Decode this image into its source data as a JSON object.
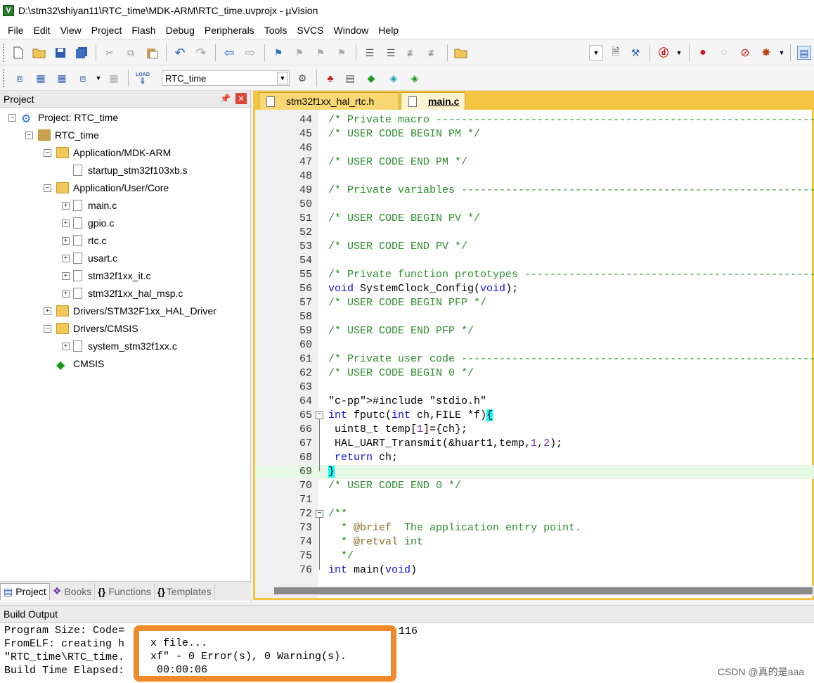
{
  "window": {
    "title": "D:\\stm32\\shiyan11\\RTC_time\\MDK-ARM\\RTC_time.uvprojx - µVision",
    "icon_letter": "V"
  },
  "menu": [
    "File",
    "Edit",
    "View",
    "Project",
    "Flash",
    "Debug",
    "Peripherals",
    "Tools",
    "SVCS",
    "Window",
    "Help"
  ],
  "toolbar2": {
    "target": "RTC_time",
    "load_label": "LOAD"
  },
  "project_panel": {
    "title": "Project",
    "pin": "❓",
    "tree": [
      {
        "label": "Project: RTC_time"
      },
      {
        "label": "RTC_time"
      },
      {
        "label": "Application/MDK-ARM"
      },
      {
        "label": "startup_stm32f103xb.s"
      },
      {
        "label": "Application/User/Core"
      },
      {
        "label": "main.c"
      },
      {
        "label": "gpio.c"
      },
      {
        "label": "rtc.c"
      },
      {
        "label": "usart.c"
      },
      {
        "label": "stm32f1xx_it.c"
      },
      {
        "label": "stm32f1xx_hal_msp.c"
      },
      {
        "label": "Drivers/STM32F1xx_HAL_Driver"
      },
      {
        "label": "Drivers/CMSIS"
      },
      {
        "label": "system_stm32f1xx.c"
      },
      {
        "label": "CMSIS"
      }
    ],
    "tabs": [
      "Project",
      "Books",
      "Functions",
      "Templates"
    ]
  },
  "editor": {
    "tabs": [
      "stm32f1xx_hal_rtc.h",
      "main.c"
    ],
    "lines": [
      {
        "n": "44",
        "t": "/* Private macro -------------------------------------------------------------"
      },
      {
        "n": "45",
        "t": "/* USER CODE BEGIN PM */"
      },
      {
        "n": "46",
        "t": ""
      },
      {
        "n": "47",
        "t": "/* USER CODE END PM */"
      },
      {
        "n": "48",
        "t": ""
      },
      {
        "n": "49",
        "t": "/* Private variables ---------------------------------------------------------"
      },
      {
        "n": "50",
        "t": ""
      },
      {
        "n": "51",
        "t": "/* USER CODE BEGIN PV */"
      },
      {
        "n": "52",
        "t": ""
      },
      {
        "n": "53",
        "t": "/* USER CODE END PV */"
      },
      {
        "n": "54",
        "t": ""
      },
      {
        "n": "55",
        "t": "/* Private function prototypes -----------------------------------------------"
      },
      {
        "n": "56",
        "t": "void SystemClock_Config(void);"
      },
      {
        "n": "57",
        "t": "/* USER CODE BEGIN PFP */"
      },
      {
        "n": "58",
        "t": ""
      },
      {
        "n": "59",
        "t": "/* USER CODE END PFP */"
      },
      {
        "n": "60",
        "t": ""
      },
      {
        "n": "61",
        "t": "/* Private user code ---------------------------------------------------------"
      },
      {
        "n": "62",
        "t": "/* USER CODE BEGIN 0 */"
      },
      {
        "n": "63",
        "t": ""
      },
      {
        "n": "64",
        "t": "#include \"stdio.h\""
      },
      {
        "n": "65",
        "t": "int fputc(int ch,FILE *f){"
      },
      {
        "n": "66",
        "t": " uint8_t temp[1]={ch};"
      },
      {
        "n": "67",
        "t": " HAL_UART_Transmit(&huart1,temp,1,2);"
      },
      {
        "n": "68",
        "t": " return ch;"
      },
      {
        "n": "69",
        "t": "}"
      },
      {
        "n": "70",
        "t": "/* USER CODE END 0 */"
      },
      {
        "n": "71",
        "t": ""
      },
      {
        "n": "72",
        "t": "/**"
      },
      {
        "n": "73",
        "t": "  * @brief  The application entry point."
      },
      {
        "n": "74",
        "t": "  * @retval int"
      },
      {
        "n": "75",
        "t": "  */"
      },
      {
        "n": "76",
        "t": "int main(void)"
      }
    ]
  },
  "build_output": {
    "title": "Build Output",
    "lines": [
      "Program Size: Code=",
      "FromELF: creating h",
      "\"RTC_time\\RTC_time.",
      "Build Time Elapsed:"
    ],
    "lines_right": [
      "116",
      "x file...",
      "xf\" - 0 Error(s), 0 Warning(s).",
      " 00:00:06"
    ]
  },
  "watermark": "CSDN @真的是aaa"
}
